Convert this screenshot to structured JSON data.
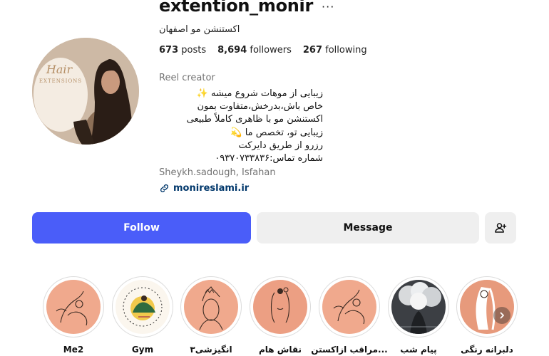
{
  "profile": {
    "username": "extention_monir",
    "more_label": "···",
    "display_name": "اکستنشن مو اصفهان",
    "avatar_logo_text": "Hair Extensions",
    "stats": [
      {
        "value": "673",
        "label": "posts"
      },
      {
        "value": "8,694",
        "label": "followers"
      },
      {
        "value": "267",
        "label": "following"
      }
    ],
    "category": "Reel creator",
    "bio_lines": [
      "زیبایی از موهات شروع میشه ✨",
      "خاص باش،بدرخش،متفاوت بمون",
      "اکستنشن مو با ظاهری کاملاً طبیعی",
      "زیبایی تو، تخصص ما 💫",
      "رزرو از طریق دایرکت",
      "شماره تماس:۰۹۳۷۰۷۳۳۸۳۶"
    ],
    "location": "Sheykh.sadough, Isfahan",
    "link": "monireslami.ir"
  },
  "actions": {
    "follow": "Follow",
    "message": "Message"
  },
  "highlights": [
    {
      "label": "Me2"
    },
    {
      "label": "Gym"
    },
    {
      "label": "انگیزشی۳"
    },
    {
      "label": "نقاش هام"
    },
    {
      "label": "مراقب ازاکستن..."
    },
    {
      "label": "پیام شب"
    },
    {
      "label": "دلبرانه رنگی"
    }
  ],
  "colors": {
    "primary": "#4a5df9",
    "secondary_button": "#efefef",
    "link": "#00376b",
    "muted": "#737373",
    "highlight_bg": "#f0a98d"
  }
}
